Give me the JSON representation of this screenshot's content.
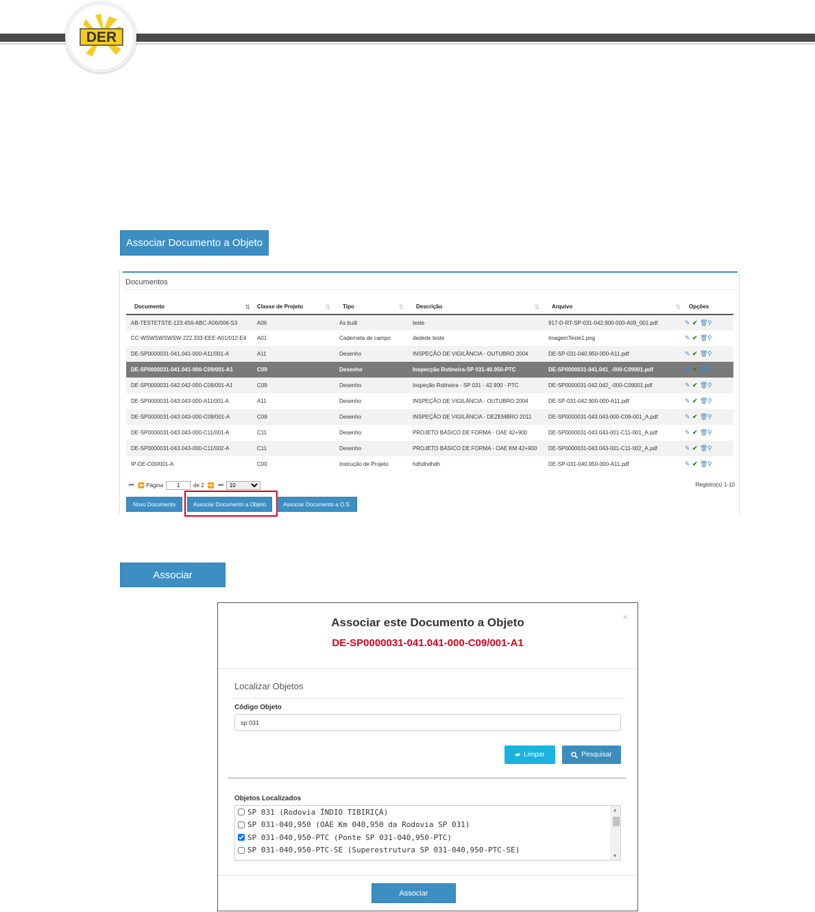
{
  "header": {
    "logo_text": "DER"
  },
  "top_button_label": "Associar Documento a Objeto",
  "panel": {
    "title": "Documentos",
    "columns": [
      "Documento",
      "Classe de Projeto",
      "Tipo",
      "Descrição",
      "Arquivo",
      "Opções"
    ],
    "rows": [
      {
        "doc": "AB-TESTETSTE-123.456-ABC-A06/006-S3",
        "classe": "A06",
        "tipo": "As built",
        "desc": "teste",
        "arquivo": "917-D-RT-SP-031-042,900-000-A09_001.pdf"
      },
      {
        "doc": "CC-WSWSWSWSW-222.333-EEE-A01/012-E4",
        "classe": "A01",
        "tipo": "Caderneta de campo",
        "desc": "dedede teste",
        "arquivo": "ImagemTeste1.png"
      },
      {
        "doc": "DE-SP0000031-041.041-000-A11/001-A",
        "classe": "A11",
        "tipo": "Desenho",
        "desc": "INSPEÇÃO DE VIGILÂNCIA - OUTUBRO 2004",
        "arquivo": "DE-SP-031-040.950-000-A11.pdf"
      },
      {
        "doc": "DE-SP0000031-041.041-000-C09/001-A1",
        "classe": "C09",
        "tipo": "Desenho",
        "desc": "Inspecção Rotineira-SP 031-40.950-PTC",
        "arquivo": "DE-SP0000031-041.041_-000-C09001.pdf"
      },
      {
        "doc": "DE-SP0000031-042.042-000-C09/001-A1",
        "classe": "C09",
        "tipo": "Desenho",
        "desc": "Inspeção Rotineira - SP 031 - 42.900 - PTC",
        "arquivo": "DE-SP0000031-042.042_-000-C09001.pdf"
      },
      {
        "doc": "DE-SP0000031-043.043-000-A11/001-A",
        "classe": "A11",
        "tipo": "Desenho",
        "desc": "INSPEÇÃO DE VIGILÂNCIA - OUTUBRO 2004",
        "arquivo": "DE-SP-031-042.900-000-A11.pdf"
      },
      {
        "doc": "DE-SP0000031-043.043-000-C09/001-A",
        "classe": "C09",
        "tipo": "Desenho",
        "desc": "INSPEÇÃO DE VIGILÂNCIA - DEZEMBRO 2011",
        "arquivo": "DE-SP0000031-043.043-000-C09-001_A.pdf"
      },
      {
        "doc": "DE-SP0000031-043.043-000-C11/001-A",
        "classe": "C11",
        "tipo": "Desenho",
        "desc": "PROJETO BÁSICO DE FORMA - OAE 42+900",
        "arquivo": "DE-SP0000031-043.043-001-C11-001_A.pdf"
      },
      {
        "doc": "DE-SP0000031-043.043-000-C11/002-A",
        "classe": "C11",
        "tipo": "Desenho",
        "desc": "PROJETO BÁSICO DE FORMA - OAE KM 42+900",
        "arquivo": "DE-SP0000031-043.043-001-C11-002_A.pdf"
      },
      {
        "doc": "IP-DE-C00/001-A",
        "classe": "C00",
        "tipo": "Instrução de Projeto",
        "desc": "hdhdhdhdh",
        "arquivo": "DE-SP-031-040.950-000-A11.pdf"
      }
    ],
    "selected_row": 3,
    "pager": {
      "page_label": "Página",
      "page_value": "1",
      "of_label": "de 2",
      "page_size": "10",
      "records": "Registro(s) 1-10"
    },
    "buttons": {
      "novo": "Novo Documento",
      "objeto": "Associar Documento a Objeto",
      "os": "Associar Documento a O.S."
    }
  },
  "associar_big_label": "Associar",
  "modal": {
    "title": "Associar este Documento a Objeto",
    "document_code": "DE-SP0000031-041.041-000-C09/001-A1",
    "close": "×",
    "section_title": "Localizar Objetos",
    "codigo_label": "Código Objeto",
    "codigo_value": "sp 031",
    "limpar_label": "Limpar",
    "pesquisar_label": "Pesquisar",
    "found_label": "Objetos Localizados",
    "objects": [
      {
        "label": "SP 031 (Rodovia ÍNDIO TIBIRIÇÁ)",
        "checked": false
      },
      {
        "label": "SP 031-040,950 (OAE Km 040,950 da Rodovia SP 031)",
        "checked": false
      },
      {
        "label": "SP 031-040,950-PTC (Ponte SP 031-040,950-PTC)",
        "checked": true
      },
      {
        "label": "SP 031-040,950-PTC-SE (Superestrutura SP 031-040,950-PTC-SE)",
        "checked": false
      }
    ],
    "associar_label": "Associar"
  },
  "colors": {
    "primary": "#3d8fc3",
    "highlight_red": "#e0001b",
    "limpar": "#1bb3e0",
    "logo_yellow": "#f5cc1e"
  }
}
